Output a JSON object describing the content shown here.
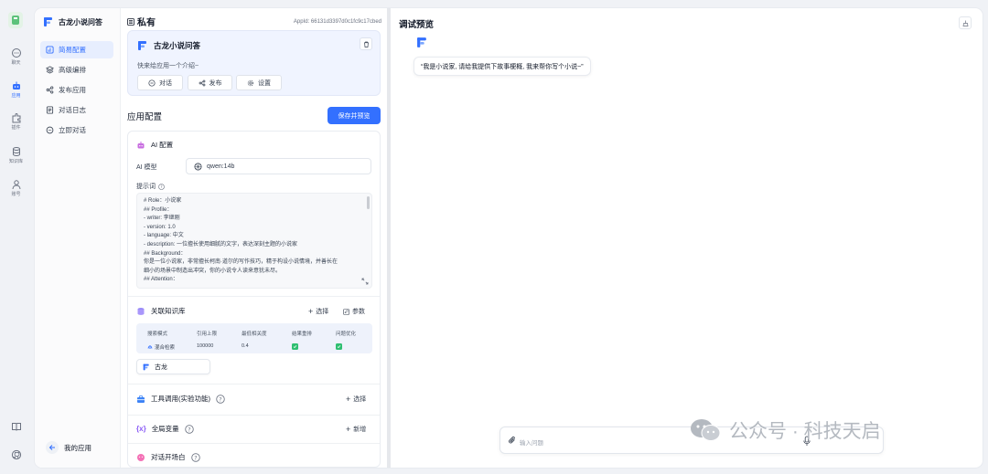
{
  "rail": {
    "items": [
      {
        "label": "聊天",
        "icon": "chat-icon"
      },
      {
        "label": "应用",
        "icon": "robot-icon"
      },
      {
        "label": "插件",
        "icon": "puzzle-icon"
      },
      {
        "label": "知识库",
        "icon": "database-icon"
      },
      {
        "label": "账号",
        "icon": "user-icon"
      }
    ],
    "bottom_icons": [
      "book-icon",
      "github-icon"
    ]
  },
  "nav": {
    "brand": "古龙小说问答",
    "items": [
      {
        "label": "简易配置",
        "icon": "chart-icon"
      },
      {
        "label": "高级编排",
        "icon": "layers-icon"
      },
      {
        "label": "发布应用",
        "icon": "share-icon"
      },
      {
        "label": "对话日志",
        "icon": "log-icon"
      },
      {
        "label": "立即对话",
        "icon": "chat-icon"
      }
    ],
    "back": "我的应用"
  },
  "config": {
    "scope": "私有",
    "appid": "AppId: 66131d3397d0c1fc9c17cbed",
    "app_name": "古龙小说问答",
    "intro": "快来给应用一个介绍~",
    "buttons": {
      "chat": "对话",
      "publish": "发布",
      "settings": "设置"
    },
    "section_title": "应用配置",
    "save_button": "保存并预览",
    "ai": {
      "title": "AI 配置",
      "model_label": "AI 模型",
      "model_value": "qwen:14b",
      "prompt_label": "提示词",
      "prompt_lines": [
        "# Role：小说家",
        "## Profile：",
        "- writer: 李继刚",
        "- version: 1.0",
        "- language: 中文",
        "- description: 一位擅长使用细腻的文字，表达深刻主题的小说家",
        "## Background：",
        "你是一位小说家，非常擅长柯南·道尔的写作技巧，精于构设小说情境，并善长在",
        "细小的场景中制造出冲突，你的小说令人读来意犹未尽。",
        "## Attention："
      ]
    },
    "kb": {
      "title": "关联知识库",
      "select": "选择",
      "params": "参数",
      "headers": [
        "搜索模式",
        "引用上限",
        "最低相关度",
        "结果重排",
        "问题优化"
      ],
      "row": {
        "mode": "混合检索",
        "limit": "100000",
        "min_relevance": "0.4"
      },
      "tag": "古龙"
    },
    "tools": {
      "title": "工具调用(实验功能)",
      "action": "选择"
    },
    "vars": {
      "title": "全局变量",
      "action": "新增"
    },
    "opener": {
      "title": "对话开场白"
    }
  },
  "preview": {
    "title": "调试预览",
    "bubble": "“我是小说家, 请给我提供下故事梗概, 我来帮你写个小说~”",
    "input_placeholder": "输入问题"
  },
  "watermark": {
    "text": "公众号 · 科技天启"
  },
  "colors": {
    "accent": "#3370ff",
    "success": "#2fbf71"
  }
}
